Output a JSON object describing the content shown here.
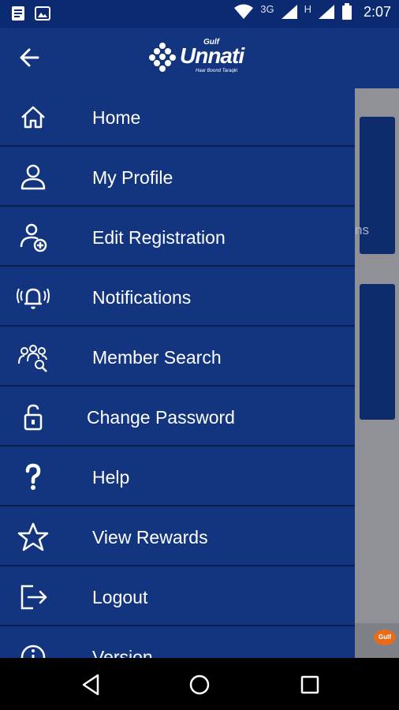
{
  "status_bar": {
    "network_3g": "3G",
    "network_h": "H",
    "time": "2:07"
  },
  "app_header": {
    "logo_brand": "Gulf",
    "logo_name": "Unnati",
    "logo_tagline": "Haar Boond Taraqki",
    "back_icon": "arrow-left-icon"
  },
  "menu": [
    {
      "label": "Home",
      "icon": "home-icon"
    },
    {
      "label": "My Profile",
      "icon": "person-icon"
    },
    {
      "label": "Edit Registration",
      "icon": "person-add-icon"
    },
    {
      "label": "Notifications",
      "icon": "bell-ringing-icon"
    },
    {
      "label": "Member Search",
      "icon": "group-search-icon"
    },
    {
      "label": "Change Password",
      "icon": "unlocked-padlock-icon"
    },
    {
      "label": "Help",
      "icon": "question-icon"
    },
    {
      "label": "View Rewards",
      "icon": "star-icon"
    },
    {
      "label": "Logout",
      "icon": "logout-icon"
    },
    {
      "label": "Version",
      "icon": "info-icon"
    }
  ],
  "background_app": {
    "fragment_text": "ns",
    "corner_logo": "Gulf"
  },
  "colors": {
    "header_blue": "#133580",
    "status_bar": "#0c2a72",
    "divider": "#0a1f52"
  }
}
